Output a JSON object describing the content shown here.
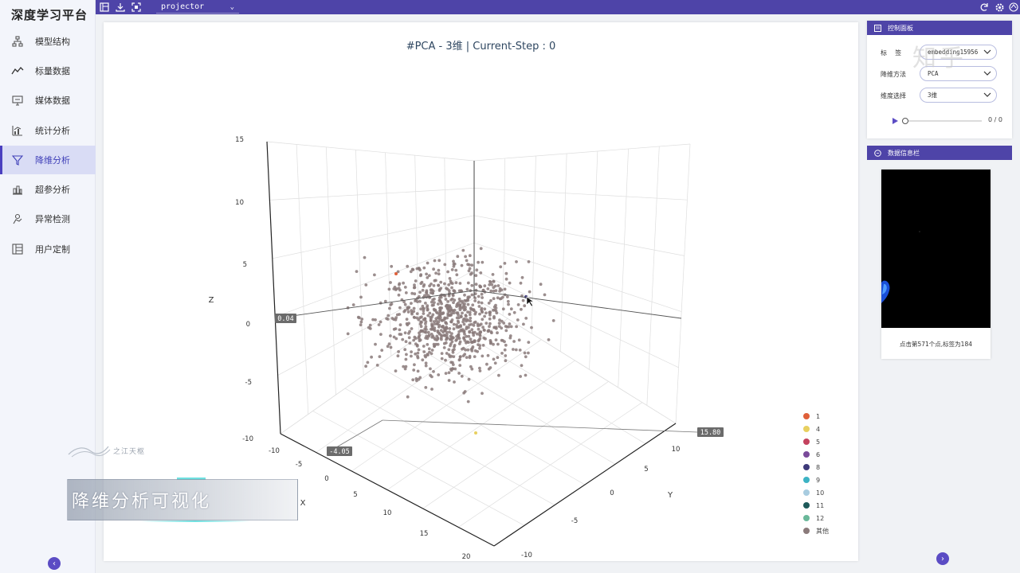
{
  "brand": "深度学习平台",
  "nav": [
    {
      "label": "模型结构",
      "icon": "model-structure-icon"
    },
    {
      "label": "标量数据",
      "icon": "line-chart-icon"
    },
    {
      "label": "媒体数据",
      "icon": "monitor-icon"
    },
    {
      "label": "统计分析",
      "icon": "stats-chart-icon"
    },
    {
      "label": "降维分析",
      "icon": "funnel-icon",
      "active": true
    },
    {
      "label": "超参分析",
      "icon": "hyperparam-icon"
    },
    {
      "label": "异常检测",
      "icon": "detect-icon"
    },
    {
      "label": "用户定制",
      "icon": "custom-icon"
    }
  ],
  "toolbar": {
    "project": "projector",
    "icons": [
      "panel-icon",
      "download-icon",
      "fullscreen-icon",
      "refresh-icon",
      "settings-icon",
      "language-icon"
    ]
  },
  "chart_data": {
    "type": "scatter",
    "dimension": "3D",
    "title": "#PCA - 3维 | Current-Step : 0",
    "xlabel": "X",
    "ylabel": "Y",
    "zlabel": "Z",
    "x_ticks": [
      "-10",
      "-5",
      "0",
      "5",
      "10",
      "15",
      "20"
    ],
    "y_ticks": [
      "10",
      "5",
      "0",
      "-5",
      "-10"
    ],
    "z_ticks": [
      "15",
      "10",
      "5",
      "0",
      "-5",
      "-10"
    ],
    "hover_labels": {
      "x": "-4.05",
      "y": "15.80",
      "z": "0.04"
    },
    "grid": true,
    "legend_position": "bottom-right",
    "legend": [
      {
        "name": "1",
        "color": "#e0603a"
      },
      {
        "name": "4",
        "color": "#e8d060"
      },
      {
        "name": "5",
        "color": "#c4425e"
      },
      {
        "name": "6",
        "color": "#7a4a9a"
      },
      {
        "name": "8",
        "color": "#3e3a7a"
      },
      {
        "name": "9",
        "color": "#3cb3c4"
      },
      {
        "name": "10",
        "color": "#a8cce0"
      },
      {
        "name": "11",
        "color": "#1e5a5a"
      },
      {
        "name": "12",
        "color": "#6ab89a"
      },
      {
        "name": "其他",
        "color": "#8a7a7a"
      }
    ],
    "point_color": "#8a7a7a"
  },
  "control_panel": {
    "title": "控制面板",
    "fields": [
      {
        "label": "标    签",
        "value": "embedding15956"
      },
      {
        "label": "降维方法",
        "value": "PCA"
      },
      {
        "label": "维度选择",
        "value": "3维"
      }
    ],
    "progress": 0,
    "step_text": "0 / 0"
  },
  "info_panel": {
    "title": "数据信息栏",
    "text": "点击第571个点,标签为184"
  },
  "watermark": {
    "zhihu": "知乎",
    "caption": "降维分析可视化",
    "logo_text": "之江天枢"
  }
}
